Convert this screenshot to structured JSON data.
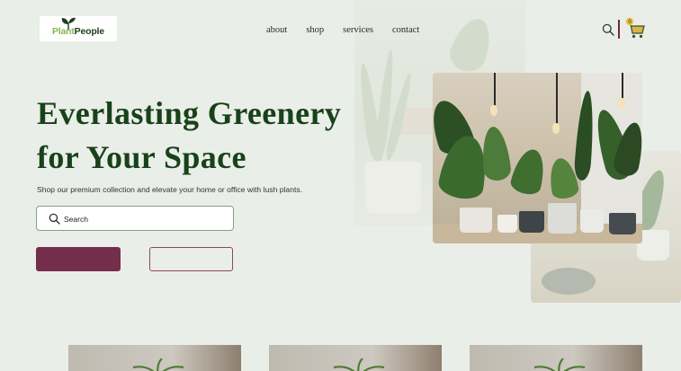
{
  "brand": {
    "part1": "Plant",
    "part2": "People"
  },
  "nav": {
    "items": [
      "about",
      "shop",
      "services",
      "contact"
    ]
  },
  "cart": {
    "count": "0"
  },
  "hero": {
    "title_line1": "Everlasting Greenery",
    "title_line2": "for Your Space",
    "subtitle": "Shop our premium collection and elevate your home or office with lush plants."
  },
  "search": {
    "placeholder": "Search",
    "value": ""
  },
  "buttons": {
    "primary_label": "",
    "secondary_label": ""
  },
  "colors": {
    "brand_green": "#18421a",
    "accent": "#742d4a",
    "background": "#eaeee8",
    "leaf_light": "#8bb556"
  },
  "icons": {
    "search": "search-icon",
    "cart": "cart-icon",
    "logo": "sprout-icon"
  }
}
